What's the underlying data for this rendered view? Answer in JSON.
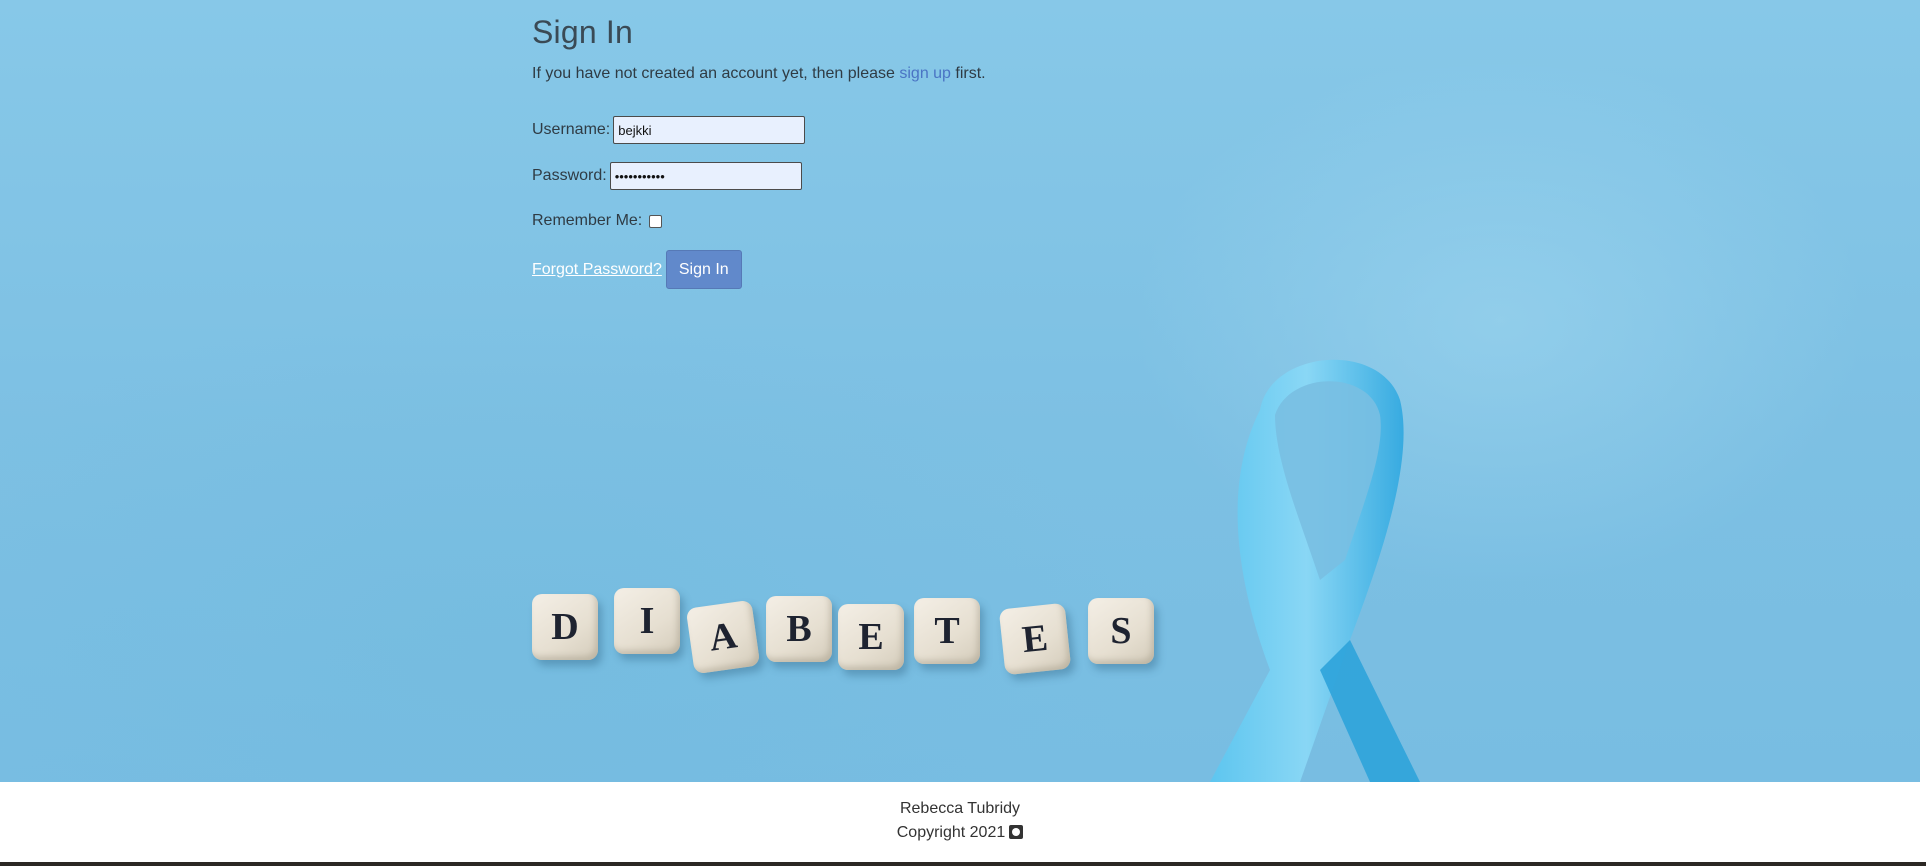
{
  "signin": {
    "title": "Sign In",
    "intro_before": "If you have not created an account yet, then please ",
    "intro_link": "sign up",
    "intro_after": " first.",
    "username_label": "Username:",
    "username_value": "bejkki",
    "password_label": "Password:",
    "password_value": "•••••••••••",
    "remember_label": "Remember Me:",
    "remember_checked": false,
    "forgot_label": "Forgot Password?",
    "submit_label": "Sign In"
  },
  "hero": {
    "dice_letters": [
      "D",
      "I",
      "A",
      "B",
      "E",
      "T",
      "E",
      "S"
    ]
  },
  "footer": {
    "name": "Rebecca Tubridy",
    "copyright": "Copyright 2021",
    "icon": "github-icon"
  },
  "colors": {
    "background": "#7dc0e3",
    "link": "#4a74c4",
    "button": "#6189cb",
    "ribbon": "#3fb1e6"
  }
}
